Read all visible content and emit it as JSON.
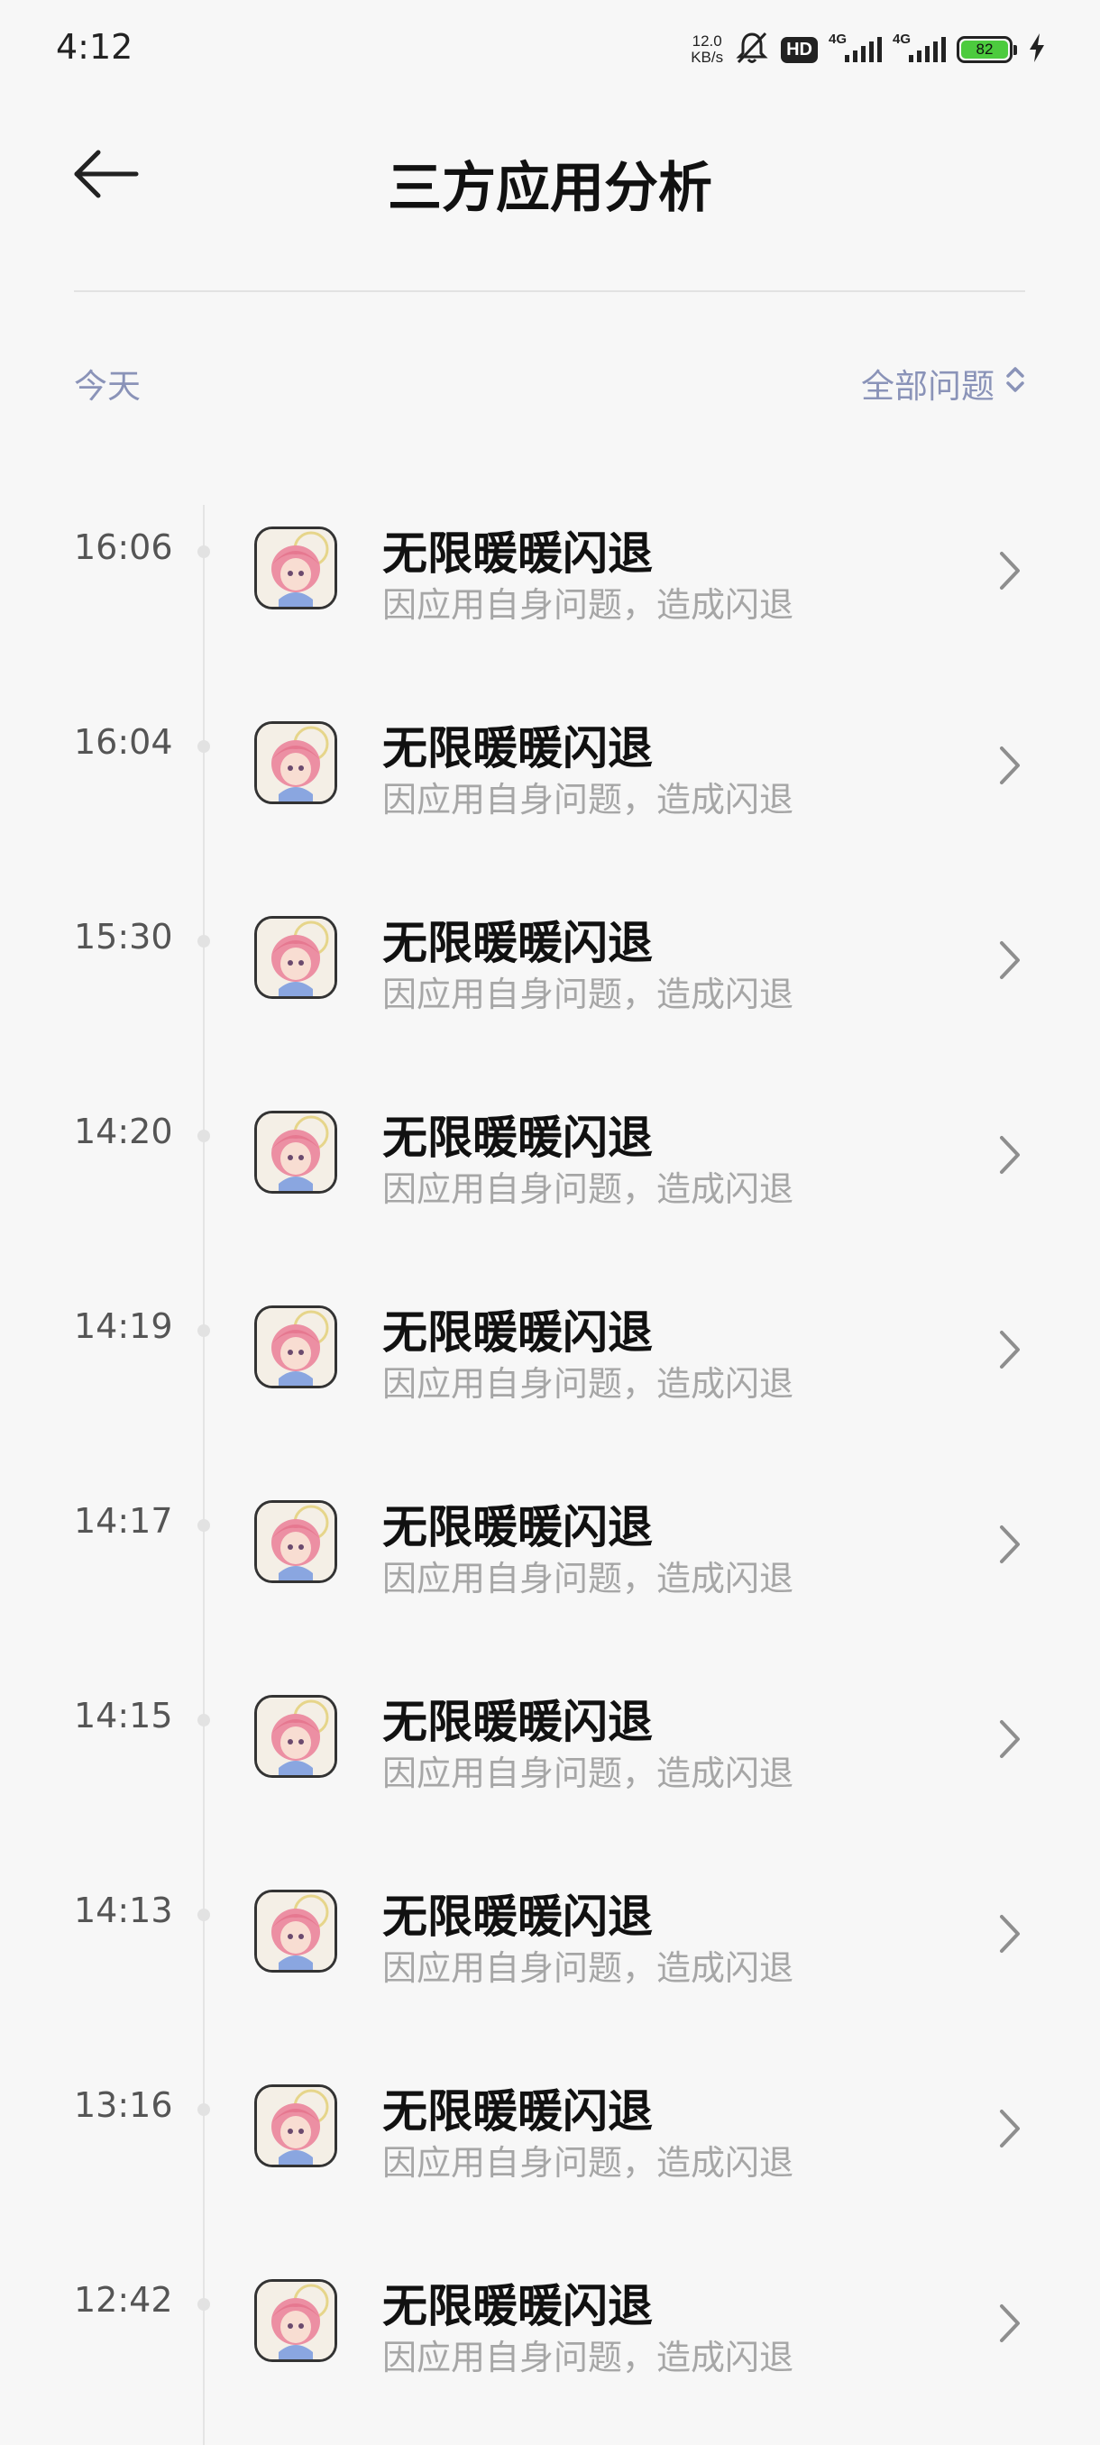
{
  "status_bar": {
    "time": "4:12",
    "net_speed_value": "12.0",
    "net_speed_unit": "KB/s",
    "hd_label": "HD",
    "signal1_label": "4G",
    "signal2_label": "4G",
    "battery_level": "82",
    "icons": [
      "bell-off-icon",
      "hd-icon",
      "signal-icon",
      "signal-icon",
      "battery-icon",
      "charging-icon"
    ]
  },
  "header": {
    "title": "三方应用分析",
    "back_icon": "arrow-left-icon"
  },
  "section": {
    "date_label": "今天",
    "filter_label": "全部问题",
    "filter_icon": "chevron-updown-icon"
  },
  "items": [
    {
      "time": "16:06",
      "title": "无限暖暖闪退",
      "subtitle": "因应用自身问题，造成闪退"
    },
    {
      "time": "16:04",
      "title": "无限暖暖闪退",
      "subtitle": "因应用自身问题，造成闪退"
    },
    {
      "time": "15:30",
      "title": "无限暖暖闪退",
      "subtitle": "因应用自身问题，造成闪退"
    },
    {
      "time": "14:20",
      "title": "无限暖暖闪退",
      "subtitle": "因应用自身问题，造成闪退"
    },
    {
      "time": "14:19",
      "title": "无限暖暖闪退",
      "subtitle": "因应用自身问题，造成闪退"
    },
    {
      "time": "14:17",
      "title": "无限暖暖闪退",
      "subtitle": "因应用自身问题，造成闪退"
    },
    {
      "time": "14:15",
      "title": "无限暖暖闪退",
      "subtitle": "因应用自身问题，造成闪退"
    },
    {
      "time": "14:13",
      "title": "无限暖暖闪退",
      "subtitle": "因应用自身问题，造成闪退"
    },
    {
      "time": "13:16",
      "title": "无限暖暖闪退",
      "subtitle": "因应用自身问题，造成闪退"
    },
    {
      "time": "12:42",
      "title": "无限暖暖闪退",
      "subtitle": "因应用自身问题，造成闪退"
    }
  ],
  "colors": {
    "background": "#f7f7f7",
    "accent_text": "#8a93b8",
    "battery_green": "#4ccb3e"
  }
}
